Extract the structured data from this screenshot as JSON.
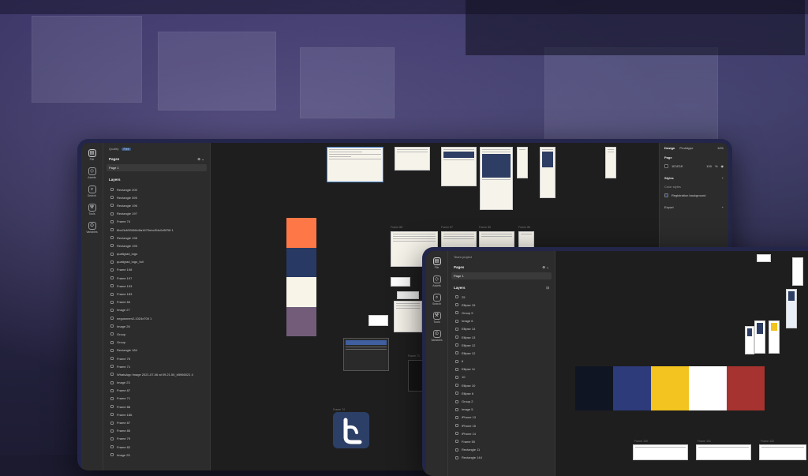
{
  "colors": {
    "palette1": [
      "#fe7847",
      "#283a63",
      "#f8f5e8",
      "#725c7a"
    ],
    "palette2": [
      "#0f1523",
      "#2d3b7a",
      "#f3c31f",
      "#ffffff",
      "#a6332f"
    ]
  },
  "left_device": {
    "project": "Qualify",
    "project_badge": "Free",
    "rail": [
      {
        "label": "File",
        "icon": "file-icon"
      },
      {
        "label": "Assets",
        "icon": "assets-icon"
      },
      {
        "label": "Search",
        "icon": "search-icon"
      },
      {
        "label": "Tools",
        "icon": "tools-icon"
      },
      {
        "label": "Variables",
        "icon": "variables-icon"
      }
    ],
    "pages_title": "Pages",
    "page_item": "Page 1",
    "layers_title": "Layers",
    "layers": [
      "Rectangle 200",
      "Rectangle 395",
      "Rectangle 196",
      "Rectangle 197",
      "Frame 74",
      "6be2b4f00f46b4fa1670ebcf04c0d5f76f 1",
      "Rectangle 198",
      "Rectangle 195",
      "qualigrad_logo",
      "qualigrad_logo_full",
      "Frame 198",
      "Frame 197",
      "Frame 193",
      "Frame 183",
      "Frame 84",
      "Image 27",
      "negusnnen2-1024x700 1",
      "Image 26",
      "Group",
      "Group",
      "Rectangle 184",
      "Frame 75",
      "Frame 71",
      "WhatsApp Image 2021-07-06 at 09.21.50_b5966021 4",
      "Image 23",
      "Frame 87",
      "Frame 71",
      "Frame 88",
      "Frame 186",
      "Frame 87",
      "Frame 85",
      "Frame 79",
      "Frame 82",
      "Image 25"
    ],
    "right_panel": {
      "tab_design": "Design",
      "tab_prototype": "Prototype",
      "zoom": "14%",
      "page_label": "Page",
      "page_color": "1E1E1E",
      "page_opacity": "100",
      "page_pct": "%",
      "styles_label": "Styles",
      "color_styles_label": "Color styles",
      "color_style_item": "Registration background",
      "export_label": "Export"
    },
    "frame_labels": [
      "Frame 88",
      "Frame 87",
      "Frame 85",
      "Frame 86",
      "Frame 71",
      "Frame 74"
    ]
  },
  "right_device": {
    "project": "Team project",
    "rail": [
      {
        "label": "File",
        "icon": "file-icon"
      },
      {
        "label": "Assets",
        "icon": "assets-icon"
      },
      {
        "label": "Search",
        "icon": "search-icon"
      },
      {
        "label": "Tools",
        "icon": "tools-icon"
      },
      {
        "label": "Variables",
        "icon": "variables-icon"
      }
    ],
    "pages_title": "Pages",
    "page_item": "Page 1",
    "layers_title": "Layers",
    "layers": [
      "25",
      "Ellipse 15",
      "Group 9",
      "Image 6",
      "Ellipse 14",
      "Ellipse 13",
      "Ellipse 12",
      "Ellipse 12",
      "6",
      "Ellipse 11",
      "10",
      "Ellipse 10",
      "Ellipse 6",
      "Group 2",
      "Image 5",
      "iPhone 13",
      "iPhone 15",
      "iPhone 14",
      "Frame 50",
      "Rectangle 11",
      "Rectangle 144"
    ],
    "frame_labels": [
      "Frame 130",
      "Frame 131",
      "Frame 132"
    ]
  }
}
